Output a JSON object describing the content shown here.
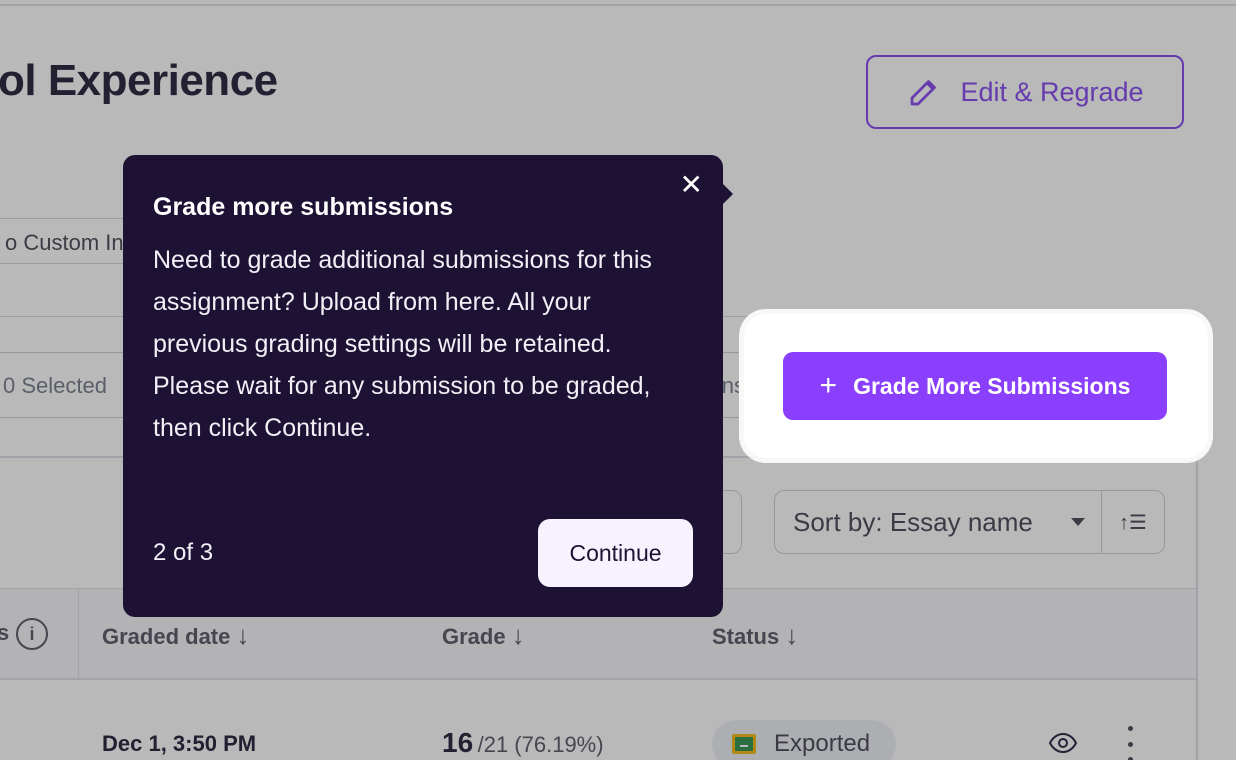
{
  "header": {
    "title": "ol Experience",
    "edit_button_label": "Edit & Regrade"
  },
  "chips": {
    "custom_label": "o Custom In"
  },
  "toolbar": {
    "selected_label": "0 Selected",
    "cut_label": "ns",
    "grade_more_label": "Grade More Submissions"
  },
  "sort": {
    "label": "Sort by: Essay name",
    "direction_icon": "↑☰"
  },
  "table": {
    "columns": [
      {
        "label": "s"
      },
      {
        "label": "Graded date"
      },
      {
        "label": "Grade"
      },
      {
        "label": "Status"
      }
    ],
    "rows": [
      {
        "graded_date": "Dec 1, 3:50 PM",
        "grade": "16",
        "grade_detail": "/21 (76.19%)",
        "status": "Exported"
      }
    ]
  },
  "tooltip": {
    "title": "Grade more submissions",
    "body_1": "Need to grade additional submissions for this assignment? Upload from here. All your previous grading settings will be retained.",
    "body_2": "Please wait for any submission to be graded, then click Continue.",
    "step": "2 of 3",
    "continue_label": "Continue",
    "close_symbol": "✕"
  },
  "icons": {
    "arrow_down": "↓",
    "info": "i",
    "plus": "+"
  },
  "colors": {
    "accent": "#8a3ffc",
    "accent_outline": "#7c3aed",
    "tooltip_bg": "#1d1233"
  }
}
